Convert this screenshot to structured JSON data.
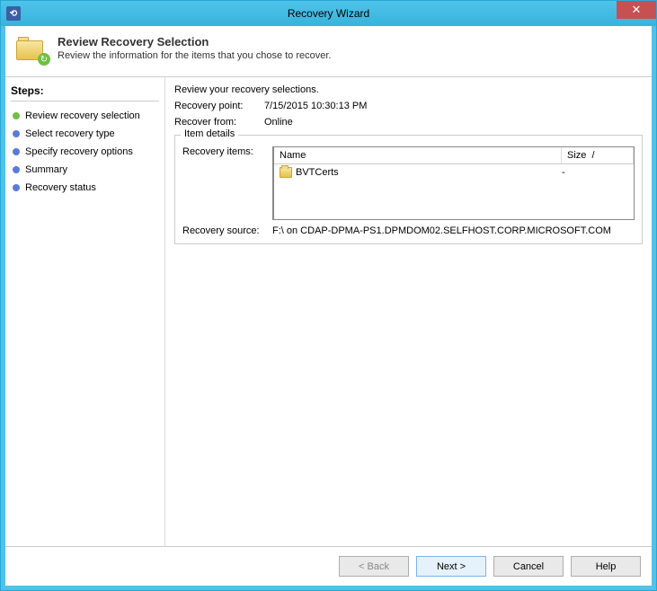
{
  "window": {
    "title": "Recovery Wizard"
  },
  "header": {
    "title": "Review Recovery Selection",
    "subtitle": "Review the information for the items that you chose to recover."
  },
  "sidebar": {
    "title": "Steps:",
    "steps": [
      {
        "label": "Review recovery selection",
        "state": "active"
      },
      {
        "label": "Select recovery type",
        "state": "pending"
      },
      {
        "label": "Specify recovery options",
        "state": "pending"
      },
      {
        "label": "Summary",
        "state": "pending"
      },
      {
        "label": "Recovery status",
        "state": "pending"
      }
    ]
  },
  "main": {
    "intro": "Review your recovery selections.",
    "recovery_point_label": "Recovery point:",
    "recovery_point_value": "7/15/2015 10:30:13 PM",
    "recover_from_label": "Recover from:",
    "recover_from_value": "Online",
    "item_details_legend": "Item details",
    "recovery_items_label": "Recovery items:",
    "grid_headers": {
      "name": "Name",
      "size": "Size"
    },
    "grid_rows": [
      {
        "name": "BVTCerts",
        "size": "-"
      }
    ],
    "recovery_source_label": "Recovery source:",
    "recovery_source_value": "F:\\ on CDAP-DPMA-PS1.DPMDOM02.SELFHOST.CORP.MICROSOFT.COM"
  },
  "buttons": {
    "back": "< Back",
    "next": "Next >",
    "cancel": "Cancel",
    "help": "Help"
  }
}
